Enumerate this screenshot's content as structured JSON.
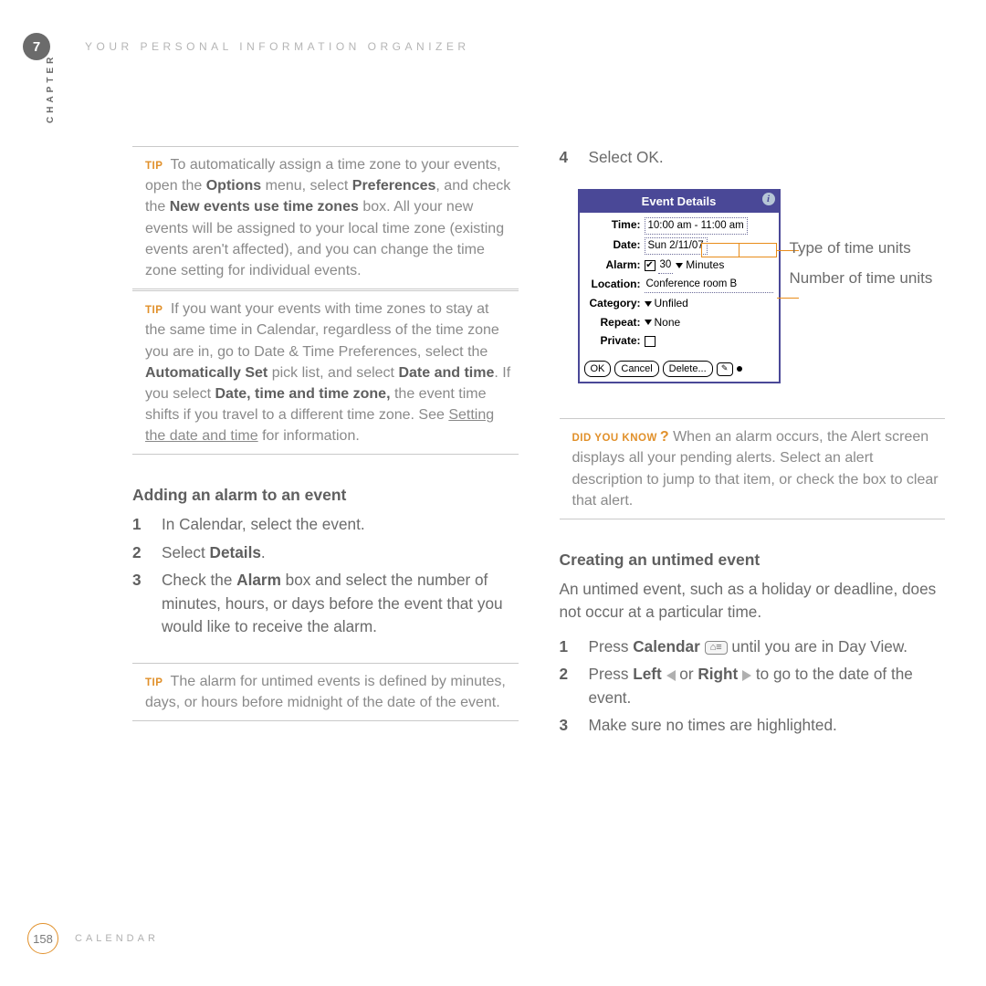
{
  "header": {
    "chapter_label": "CHAPTER",
    "chapter_number": "7",
    "title": "YOUR PERSONAL INFORMATION ORGANIZER"
  },
  "left_col": {
    "tip1": {
      "label": "TIP",
      "text_before": "To automatically assign a time zone to your events, open the ",
      "b1": "Options",
      "t2": " menu, select ",
      "b2": "Preferences",
      "t3": ", and check the ",
      "b3": "New events use time zones",
      "t4": " box. All your new events will be assigned to your local time zone (existing events aren't affected), and you can change the time zone setting for individual events."
    },
    "tip2": {
      "label": "TIP",
      "t1": "If you want your events with time zones to stay at the same time in Calendar, regardless of the time zone you are in, go to Date & Time Preferences, select the ",
      "b1": "Automatically Set",
      "t2": " pick list, and select ",
      "b2": "Date and time",
      "t3": ". If you select ",
      "b3": "Date, time and time zone,",
      "t4": " the event time shifts if you travel to a different time zone. See ",
      "link": "Setting the date and time",
      "t5": " for information."
    },
    "section_h": "Adding an alarm to an event",
    "steps": {
      "s1": "In Calendar, select the event.",
      "s2a": "Select ",
      "s2b": "Details",
      "s2c": ".",
      "s3a": "Check the ",
      "s3b": "Alarm",
      "s3c": " box and select the number of minutes, hours, or days before the event that you would like to receive the alarm."
    },
    "tip3": {
      "label": "TIP",
      "text": "The alarm for untimed events is defined by minutes, days, or hours before midnight of the date of the event."
    }
  },
  "right_col": {
    "step4_num": "4",
    "step4_text": "Select OK.",
    "event_dialog": {
      "title": "Event Details",
      "rows": {
        "time_label": "Time:",
        "time_value": "10:00 am - 11:00 am",
        "date_label": "Date:",
        "date_value": "Sun 2/11/07",
        "alarm_label": "Alarm:",
        "alarm_checked": "✔",
        "alarm_value": "30",
        "alarm_units": "Minutes",
        "location_label": "Location:",
        "location_value": "Conference room B",
        "category_label": "Category:",
        "category_value": "Unfiled",
        "repeat_label": "Repeat:",
        "repeat_value": "None",
        "private_label": "Private:"
      },
      "buttons": {
        "ok": "OK",
        "cancel": "Cancel",
        "delete": "Delete...",
        "note_glyph": "✎"
      }
    },
    "callouts": {
      "type_units": "Type of time units",
      "num_units": "Number of time units"
    },
    "dyk": {
      "label": "DID YOU KNOW",
      "q": "?",
      "text": "When an alarm occurs, the Alert screen displays all your pending alerts. Select an alert description to jump to that item, or check the box to clear that alert."
    },
    "section_h": "Creating an untimed event",
    "intro": "An untimed event, such as a holiday or deadline, does not occur at a particular time.",
    "steps": {
      "s1a": "Press ",
      "s1b": "Calendar",
      "s1_icon": "⌂≡",
      "s1c": " until you are in Day View.",
      "s2a": "Press ",
      "s2b": "Left",
      "s2c": " or ",
      "s2d": "Right",
      "s2e": " to go to the date of the event.",
      "s3": "Make sure no times are highlighted."
    }
  },
  "footer": {
    "page": "158",
    "section": "CALENDAR"
  }
}
